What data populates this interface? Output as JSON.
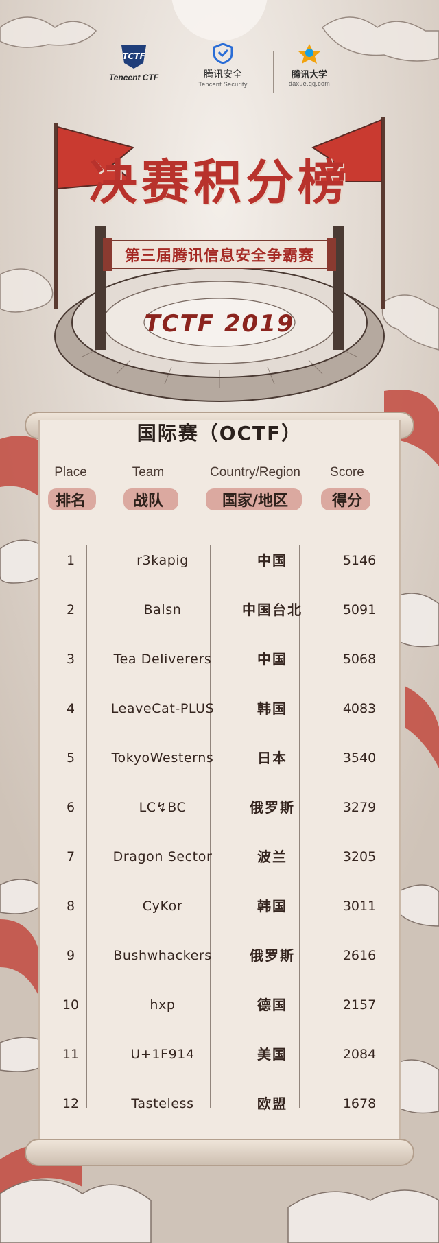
{
  "colors": {
    "accent": "#b8322c",
    "paper": "#f1e9e1",
    "ink": "#35251f"
  },
  "logos": [
    {
      "name": "Tencent CTF",
      "sub": "",
      "icon": "tctf-shield-icon"
    },
    {
      "name": "腾讯安全",
      "sub": "Tencent Security",
      "icon": "tencent-security-shield-icon"
    },
    {
      "name": "腾讯大学",
      "sub": "daxue.qq.com",
      "icon": "tencent-university-star-icon"
    }
  ],
  "title": "决赛积分榜",
  "subtitle": "第三届腾讯信息安全争霸赛",
  "event": "TCTF 2019",
  "section": "国际赛（OCTF）",
  "columns": [
    {
      "en": "Place",
      "zh": "排名"
    },
    {
      "en": "Team",
      "zh": "战队"
    },
    {
      "en": "Country/Region",
      "zh": "国家/地区"
    },
    {
      "en": "Score",
      "zh": "得分"
    }
  ],
  "rows": [
    {
      "place": "1",
      "team": "r3kapig",
      "country": "中国",
      "score": "5146"
    },
    {
      "place": "2",
      "team": "Balsn",
      "country": "中国台北",
      "score": "5091"
    },
    {
      "place": "3",
      "team": "Tea Deliverers",
      "country": "中国",
      "score": "5068"
    },
    {
      "place": "4",
      "team": "LeaveCat-PLUS",
      "country": "韩国",
      "score": "4083"
    },
    {
      "place": "5",
      "team": "TokyoWesterns",
      "country": "日本",
      "score": "3540"
    },
    {
      "place": "6",
      "team": "LC↯BC",
      "country": "俄罗斯",
      "score": "3279"
    },
    {
      "place": "7",
      "team": "Dragon Sector",
      "country": "波兰",
      "score": "3205"
    },
    {
      "place": "8",
      "team": "CyKor",
      "country": "韩国",
      "score": "3011"
    },
    {
      "place": "9",
      "team": "Bushwhackers",
      "country": "俄罗斯",
      "score": "2616"
    },
    {
      "place": "10",
      "team": "hxp",
      "country": "德国",
      "score": "2157"
    },
    {
      "place": "11",
      "team": "U+1F914",
      "country": "美国",
      "score": "2084"
    },
    {
      "place": "12",
      "team": "Tasteless",
      "country": "欧盟",
      "score": "1678"
    }
  ]
}
